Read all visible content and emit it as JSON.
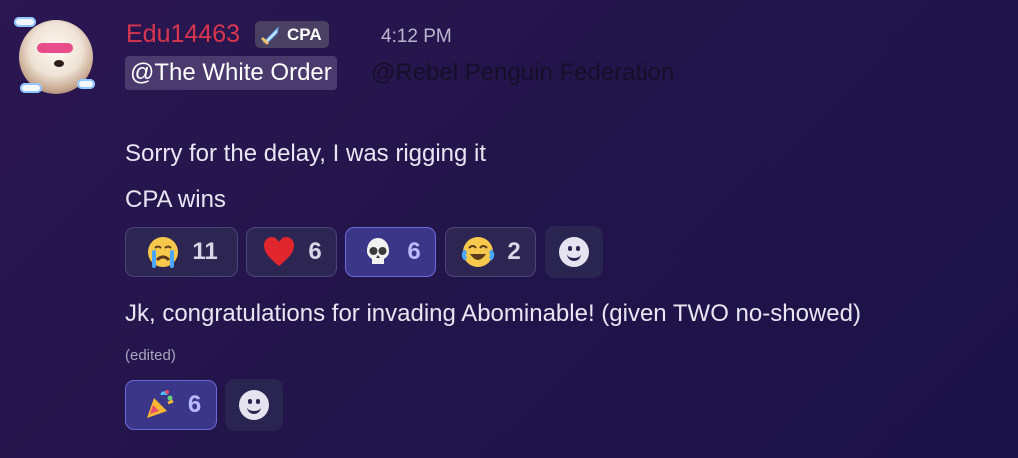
{
  "message": {
    "author": {
      "name": "Edu14463",
      "tag": "CPA",
      "name_color": "#d8364f",
      "avatar_icon": "dog-with-sunglasses-avatar",
      "tag_icon": "sword-icon"
    },
    "timestamp": "4:12 PM",
    "mentions": [
      "@The White Order",
      "@Rebel Penguin Federation"
    ],
    "lines": [
      "Sorry for the delay, I was rigging it",
      "CPA wins"
    ],
    "reactions_1": [
      {
        "emoji_name": "crying-face-icon",
        "count": "11",
        "active": false
      },
      {
        "emoji_name": "heart-icon",
        "count": "6",
        "active": false
      },
      {
        "emoji_name": "skull-icon",
        "count": "6",
        "active": true
      },
      {
        "emoji_name": "tears-of-joy-icon",
        "count": "2",
        "active": false
      }
    ],
    "followup": "Jk, congratulations for invading Abominable! (given TWO no-showed)",
    "edited_label": "(edited)",
    "reactions_2": [
      {
        "emoji_name": "party-popper-icon",
        "count": "6",
        "active": true
      }
    ]
  },
  "colors": {
    "background": "#22154a",
    "active_reaction": "#3b3687",
    "mention_background": "#4a3a6e"
  }
}
